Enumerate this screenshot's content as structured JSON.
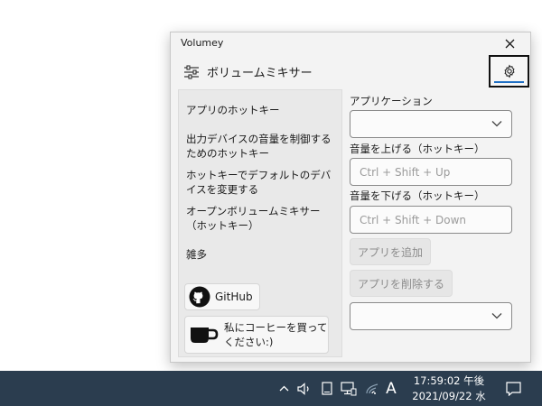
{
  "window": {
    "title": "Volumey",
    "header_title": "ボリュームミキサー"
  },
  "sidebar": {
    "items": [
      {
        "label": "アプリのホットキー"
      },
      {
        "label": "出力デバイスの音量を制御するためのホットキー"
      },
      {
        "label": "ホットキーでデフォルトのデバイスを変更する"
      },
      {
        "label": "オープンボリュームミキサー（ホットキー）"
      },
      {
        "label": "雑多"
      }
    ],
    "github_label": "GitHub",
    "coffee_label": "私にコーヒーを買ってください:)"
  },
  "main": {
    "app_label": "アプリケーション",
    "app_value": "",
    "up_label": "音量を上げる（ホットキー）",
    "up_placeholder": "Ctrl + Shift + Up",
    "down_label": "音量を下げる（ホットキー）",
    "down_placeholder": "Ctrl + Shift + Down",
    "add_button": "アプリを追加",
    "remove_button": "アプリを削除する",
    "app_list_value": ""
  },
  "taskbar": {
    "ime_label": "A",
    "time": "17:59:02 午後",
    "date": "2021/09/22 水"
  },
  "colors": {
    "accent": "#1f6fc4",
    "taskbar": "#2b3d4f",
    "window_bg": "#f3f3f3"
  },
  "icons": {
    "close": "close-icon",
    "sliders": "sliders-icon",
    "settings": "gear-icon",
    "github": "github-icon",
    "coffee": "coffee-cup-icon",
    "dropdown": "chevron-down-icon",
    "tray_chevron": "chevron-up-icon",
    "volume": "speaker-icon",
    "tablet": "tablet-icon",
    "network": "network-icon",
    "wifi": "wifi-icon",
    "notifications": "notification-icon"
  }
}
